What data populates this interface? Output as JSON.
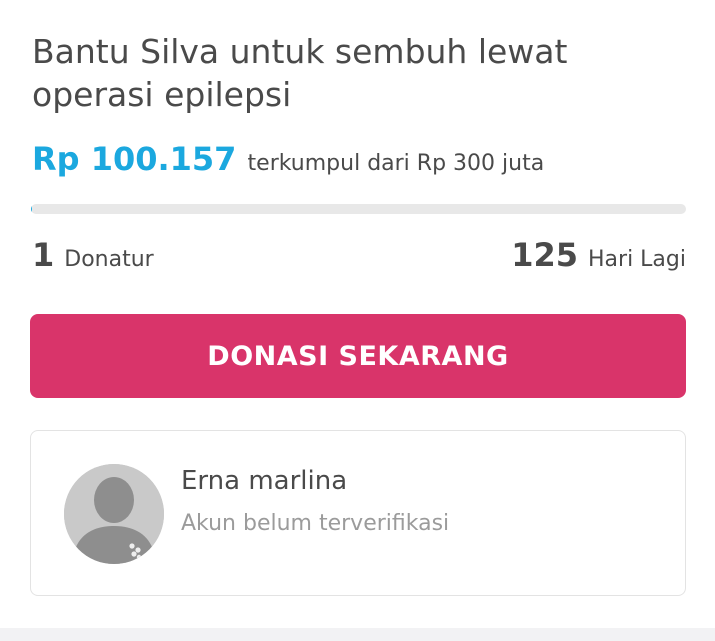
{
  "campaign": {
    "title": "Bantu Silva untuk sembuh lewat operasi epilepsi",
    "amount_collected": "Rp 100.157",
    "amount_note": "terkumpul dari Rp 300 juta",
    "progress_fraction": 0.0003
  },
  "stats": {
    "donors_count": "1",
    "donors_label": "Donatur",
    "days_left": "125",
    "days_label": "Hari Lagi"
  },
  "donate_button": {
    "label": "DONASI SEKARANG"
  },
  "fundraiser": {
    "name": "Erna marlina",
    "status": "Akun belum terverifikasi"
  },
  "colors": {
    "accent_blue": "#1ba8df",
    "button_pink": "#d9346a",
    "text_dark": "#4a4a4a",
    "text_muted": "#9b9b9b"
  }
}
